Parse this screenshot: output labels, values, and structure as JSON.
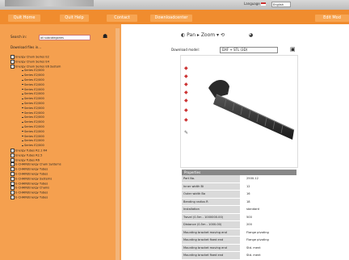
{
  "header": {
    "language_label": "Language",
    "language_value": "English"
  },
  "nav": {
    "items": [
      "Quit Home",
      "Quit Help",
      "Contact",
      "Downloadcenter"
    ],
    "right_item": "Edit Mod"
  },
  "sidebar": {
    "search_label": "Search in:",
    "search_value": "all subcategories",
    "hint": "Download files in...",
    "tree": [
      {
        "label": "Energy Chain Series E2",
        "child": false
      },
      {
        "label": "Energy Chain Series E4",
        "child": false
      },
      {
        "label": "Energy Chain Series E6 System",
        "child": false
      },
      {
        "label": "Series E2/000",
        "child": true
      },
      {
        "label": "Series E2/000",
        "child": true
      },
      {
        "label": "Series E2/000",
        "child": true
      },
      {
        "label": "Series E2/000",
        "child": true
      },
      {
        "label": "Series E2/000",
        "child": true
      },
      {
        "label": "Series E2/000",
        "child": true
      },
      {
        "label": "Series E2/000",
        "child": true
      },
      {
        "label": "Series E2/000",
        "child": true
      },
      {
        "label": "Series E2/000",
        "child": true
      },
      {
        "label": "Series E2/000",
        "child": true
      },
      {
        "label": "Series E2/000",
        "child": true
      },
      {
        "label": "Series E2/000",
        "child": true
      },
      {
        "label": "Series E2/000",
        "child": true
      },
      {
        "label": "Series E2/000",
        "child": true
      },
      {
        "label": "Series E2/000",
        "child": true
      },
      {
        "label": "Series E2/000",
        "child": true
      },
      {
        "label": "Series E2/000",
        "child": true
      },
      {
        "label": "Energy Tubes R2.1 R4",
        "child": false
      },
      {
        "label": "Energy Tubes R2.5",
        "child": false
      },
      {
        "label": "Energy Tubes R6",
        "child": false
      },
      {
        "label": "E-CHAIN/Energy Chain Systems",
        "child": false
      },
      {
        "label": "E-CHAIN/Energy Tubes",
        "child": false
      },
      {
        "label": "E-CHAIN/Energy Tubes",
        "child": false
      },
      {
        "label": "E-CHAIN/Energy Systems",
        "child": false
      },
      {
        "label": "E-CHAIN/Energy Tubes",
        "child": false
      },
      {
        "label": "E-CHAIN/Energy Chains",
        "child": false
      },
      {
        "label": "E-CHAIN/Energy Tubes",
        "child": false
      },
      {
        "label": "E-CHAIN/Energy Tubes",
        "child": false
      }
    ]
  },
  "viewer": {
    "toolbar_text": "Pan  ▸  Zoom  ▾  ⟲",
    "download_label": "Download model:",
    "download_value": "DXF + STL (3D)"
  },
  "properties": {
    "title": "Properties",
    "rows": [
      {
        "key": "Part No.",
        "value": "2500.12"
      },
      {
        "key": "Inner width Bi",
        "value": "12"
      },
      {
        "key": "Outer width Ba",
        "value": "16"
      },
      {
        "key": "Bending radius R",
        "value": "18"
      },
      {
        "key": "Installation",
        "value": "standard"
      },
      {
        "key": "Travel (0.5m - 1000000.00)",
        "value": "500"
      },
      {
        "key": "Distance (0.5m - 1000.00)",
        "value": "200"
      },
      {
        "key": "Mounting bracket moving end",
        "value": "Flange pivoting"
      },
      {
        "key": "Mounting bracket fixed end",
        "value": "Flange pivoting"
      },
      {
        "key": "Mounting bracket moving end",
        "value": "Std. ment"
      },
      {
        "key": "Mounting bracket fixed end",
        "value": "Std. ment"
      }
    ]
  }
}
